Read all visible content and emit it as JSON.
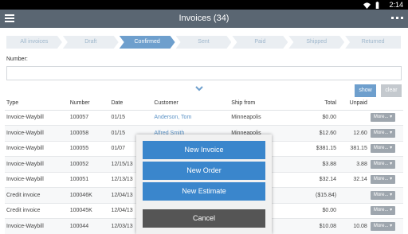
{
  "status_bar": {
    "time": "2:14",
    "icons": [
      "wifi-icon",
      "battery-icon"
    ]
  },
  "app_bar": {
    "title": "Invoices (34)"
  },
  "steps": [
    {
      "label": "All invoices",
      "active": false
    },
    {
      "label": "Draft",
      "active": false
    },
    {
      "label": "Confirmed",
      "active": true
    },
    {
      "label": "Sent",
      "active": false
    },
    {
      "label": "Paid",
      "active": false
    },
    {
      "label": "Shipped",
      "active": false
    },
    {
      "label": "Returned",
      "active": false
    }
  ],
  "filter": {
    "number_label": "Number:",
    "number_value": "",
    "show_label": "show",
    "clear_label": "clear"
  },
  "table": {
    "headers": {
      "type": "Type",
      "number": "Number",
      "date": "Date",
      "customer": "Customer",
      "ship_from": "Ship from",
      "total": "Total",
      "unpaid": "Unpaid"
    },
    "more_label": "More... ▾",
    "rows": [
      {
        "type": "Invoice-Waybill",
        "number": "100057",
        "date": "01/15",
        "customer": "Anderson, Tom",
        "ship_from": "Minneapolis",
        "total": "$0.00",
        "unpaid": ""
      },
      {
        "type": "Invoice-Waybill",
        "number": "100058",
        "date": "01/15",
        "customer": "Alfred Smith",
        "ship_from": "Minneapolis",
        "total": "$12.60",
        "unpaid": "12.60"
      },
      {
        "type": "Invoice-Waybill",
        "number": "100055",
        "date": "01/07",
        "customer": "",
        "ship_from": "",
        "total": "$381.15",
        "unpaid": "381.15"
      },
      {
        "type": "Invoice-Waybill",
        "number": "100052",
        "date": "12/15/13",
        "customer": "",
        "ship_from": "",
        "total": "$3.88",
        "unpaid": "3.88"
      },
      {
        "type": "Invoice-Waybill",
        "number": "100051",
        "date": "12/13/13",
        "customer": "",
        "ship_from": "",
        "total": "$32.14",
        "unpaid": "32.14"
      },
      {
        "type": "Credit invoice",
        "number": "100046K",
        "date": "12/04/13",
        "customer": "",
        "ship_from": "",
        "total": "($15.84)",
        "unpaid": ""
      },
      {
        "type": "Credit invoice",
        "number": "100045K",
        "date": "12/04/13",
        "customer": "",
        "ship_from": "",
        "total": "$0.00",
        "unpaid": ""
      },
      {
        "type": "Invoice-Waybill",
        "number": "100044",
        "date": "12/03/13",
        "customer": "",
        "ship_from": "",
        "total": "$10.08",
        "unpaid": "10.08"
      }
    ]
  },
  "action_menu": {
    "new_invoice": "New Invoice",
    "new_order": "New Order",
    "new_estimate": "New Estimate",
    "cancel": "Cancel"
  },
  "colors": {
    "accent": "#6e9fcd",
    "action_blue": "#3a86cc",
    "unpaid_red": "#e84a4a",
    "app_bar": "#5a6672"
  }
}
